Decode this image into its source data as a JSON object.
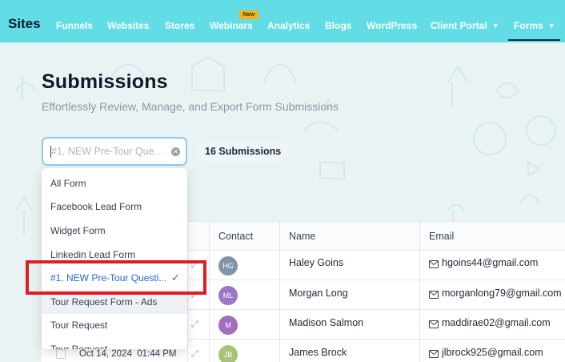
{
  "nav": {
    "brand": "Sites",
    "items": [
      {
        "label": "Funnels"
      },
      {
        "label": "Websites"
      },
      {
        "label": "Stores"
      },
      {
        "label": "Webinars",
        "badge": "New"
      },
      {
        "label": "Analytics"
      },
      {
        "label": "Blogs"
      },
      {
        "label": "WordPress"
      },
      {
        "label": "Client Portal",
        "chevron": "chevron-down-icon"
      },
      {
        "label": "Forms",
        "chevron": "chevron-down-icon",
        "active": true
      }
    ]
  },
  "page": {
    "title": "Submissions",
    "subtitle": "Effortlessly Review, Manage, and Export Form Submissions"
  },
  "filter": {
    "placeholder": "#1. NEW Pre-Tour Ques...",
    "clear_icon": "clear-icon",
    "count_label": "16 Submissions"
  },
  "dropdown": {
    "options": [
      "All Form",
      "Facebook Lead Form",
      "Widget Form",
      "Linkedin Lead Form",
      "#1. NEW Pre-Tour Questi...",
      "Tour Request Form - Ads",
      "Tour Request",
      "Tour Request"
    ],
    "selected_index": 4,
    "hover_index": 5
  },
  "table": {
    "headers": {
      "contact": "Contact",
      "name": "Name",
      "email": "Email"
    },
    "rows": [
      {
        "initials": "HG",
        "avatar_color": "#7f96a8",
        "name": "Haley Goins",
        "email": "hgoins44@gmail.com"
      },
      {
        "initials": "ML",
        "avatar_color": "#9a78c4",
        "name": "Morgan Long",
        "email": "morganlong79@gmail.com"
      },
      {
        "initials": "M",
        "avatar_color": "#a26fbf",
        "name": "Madison Salmon",
        "email": "maddirae02@gmail.com"
      },
      {
        "initials": "JB",
        "avatar_color": "#a9c27a",
        "name": "James Brock",
        "email": "jlbrock925@gmail.com",
        "date": "Oct 14, 2024",
        "time": "01:44 PM"
      }
    ]
  },
  "colors": {
    "nav_bg": "#62dde6",
    "accent": "#2563eb",
    "highlight": "#e01b24",
    "new_badge": "#f6b21a"
  }
}
